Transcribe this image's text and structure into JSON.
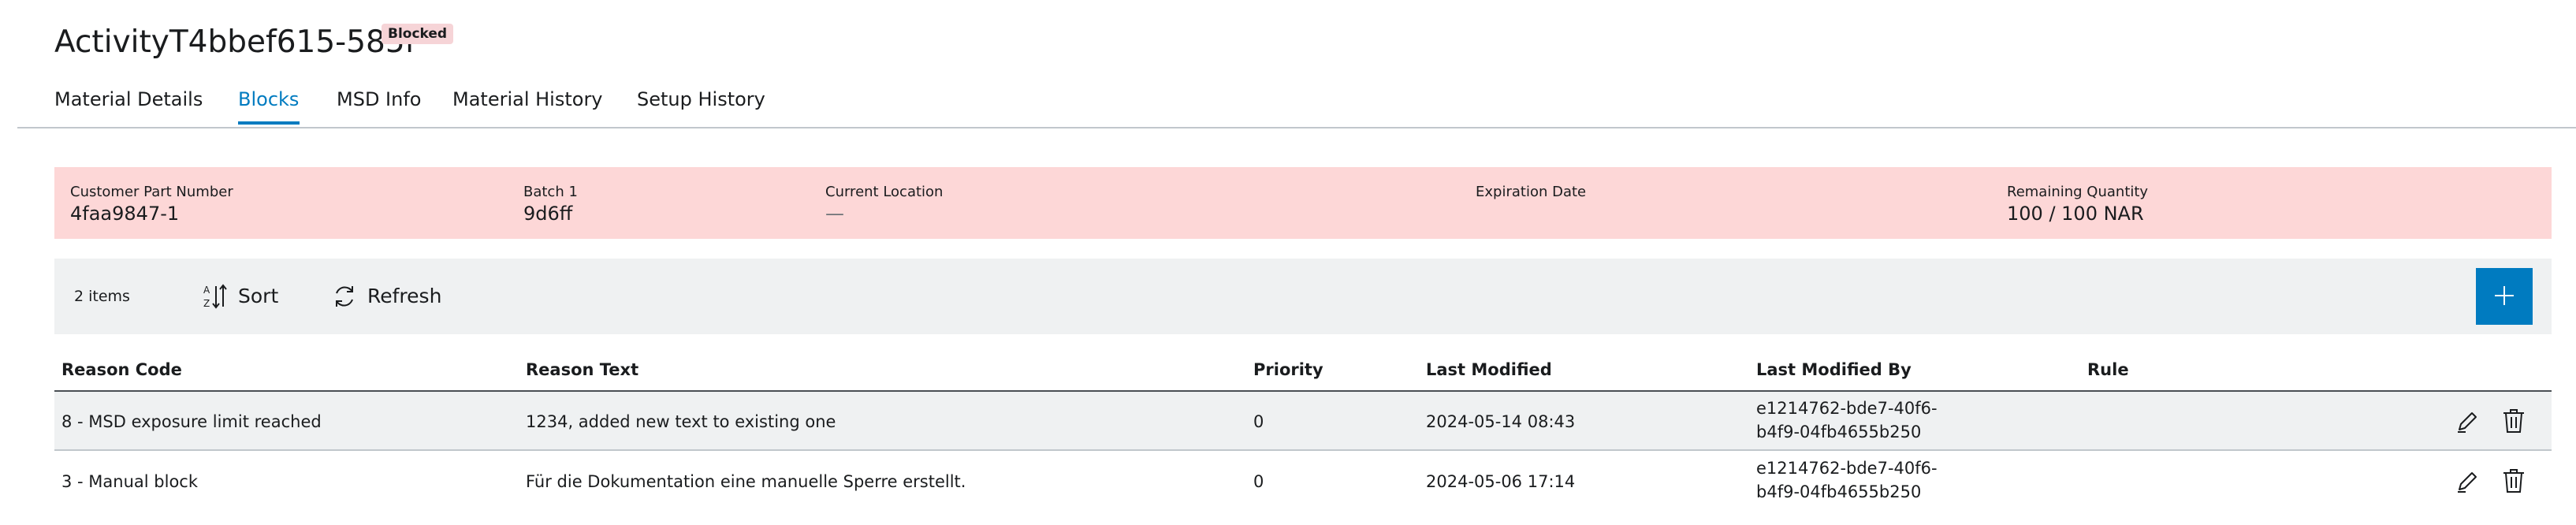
{
  "header": {
    "title": "ActivityT4bbef615-585f",
    "status_badge": "Blocked"
  },
  "tabs": [
    {
      "label": "Material Details"
    },
    {
      "label": "Blocks",
      "active": true
    },
    {
      "label": "MSD Info"
    },
    {
      "label": "Material History"
    },
    {
      "label": "Setup History"
    }
  ],
  "info": {
    "fields": [
      {
        "label": "Customer Part Number",
        "value": "4faa9847-1"
      },
      {
        "label": "Batch 1",
        "value": "9d6ff"
      },
      {
        "label": "Current Location",
        "value": "—"
      },
      {
        "label": "Expiration Date",
        "value": ""
      },
      {
        "label": "Remaining Quantity",
        "value": "100 / 100 NAR"
      }
    ]
  },
  "toolbar": {
    "item_count": "2 items",
    "sort_label": "Sort",
    "refresh_label": "Refresh",
    "add_icon": "plus-icon"
  },
  "table": {
    "columns": [
      "Reason Code",
      "Reason Text",
      "Priority",
      "Last Modified",
      "Last Modified By",
      "Rule"
    ],
    "rows": [
      {
        "reason_code": "8 - MSD exposure limit reached",
        "reason_text": "1234, added new text to existing one",
        "priority": "0",
        "last_modified": "2024-05-14 08:43",
        "last_modified_by": "e1214762-bde7-40f6-b4f9-04fb4655b250",
        "rule": ""
      },
      {
        "reason_code": "3 - Manual block",
        "reason_text": "Für die Dokumentation eine manuelle Sperre erstellt.",
        "priority": "0",
        "last_modified": "2024-05-06 17:14",
        "last_modified_by": "e1214762-bde7-40f6-b4f9-04fb4655b250",
        "rule": ""
      }
    ],
    "row_actions": [
      "edit-icon",
      "delete-icon"
    ]
  },
  "colors": {
    "accent": "#007bc0",
    "blocked_background": "#fdd7d7",
    "badge_background": "#f6d4d7",
    "toolbar_background": "#eff1f2",
    "text": "#1a1c1e"
  }
}
